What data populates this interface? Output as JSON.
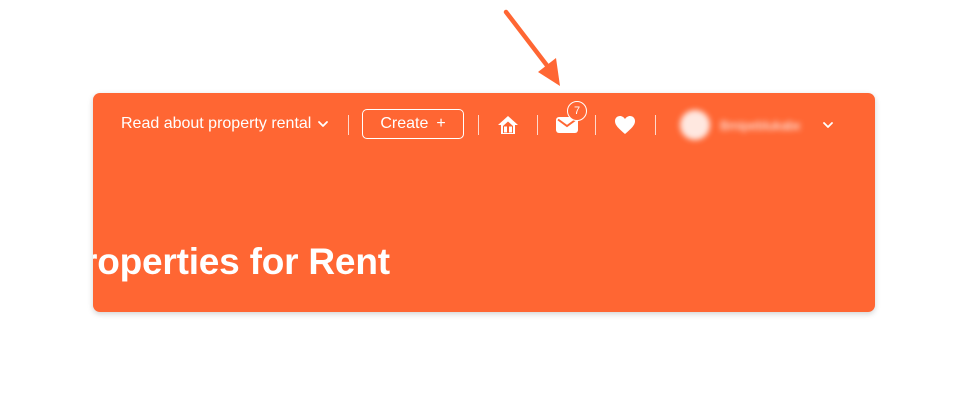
{
  "header": {
    "read_link_label": "Read about property rental",
    "create_label": "Create",
    "create_plus": "+",
    "messages_count": "7",
    "username": "Bmipeblukabel"
  },
  "icons": {
    "read_chevron": "chevron-down-icon",
    "home": "home-icon",
    "messages": "mail-icon",
    "favorites": "heart-icon",
    "user_chevron": "chevron-down-icon",
    "annotation": "arrow-pointer-icon"
  },
  "page": {
    "title": "roperties for Rent"
  },
  "colors": {
    "brand": "#ff6633",
    "annotation_arrow": "#ff6633",
    "text": "#ffffff"
  }
}
